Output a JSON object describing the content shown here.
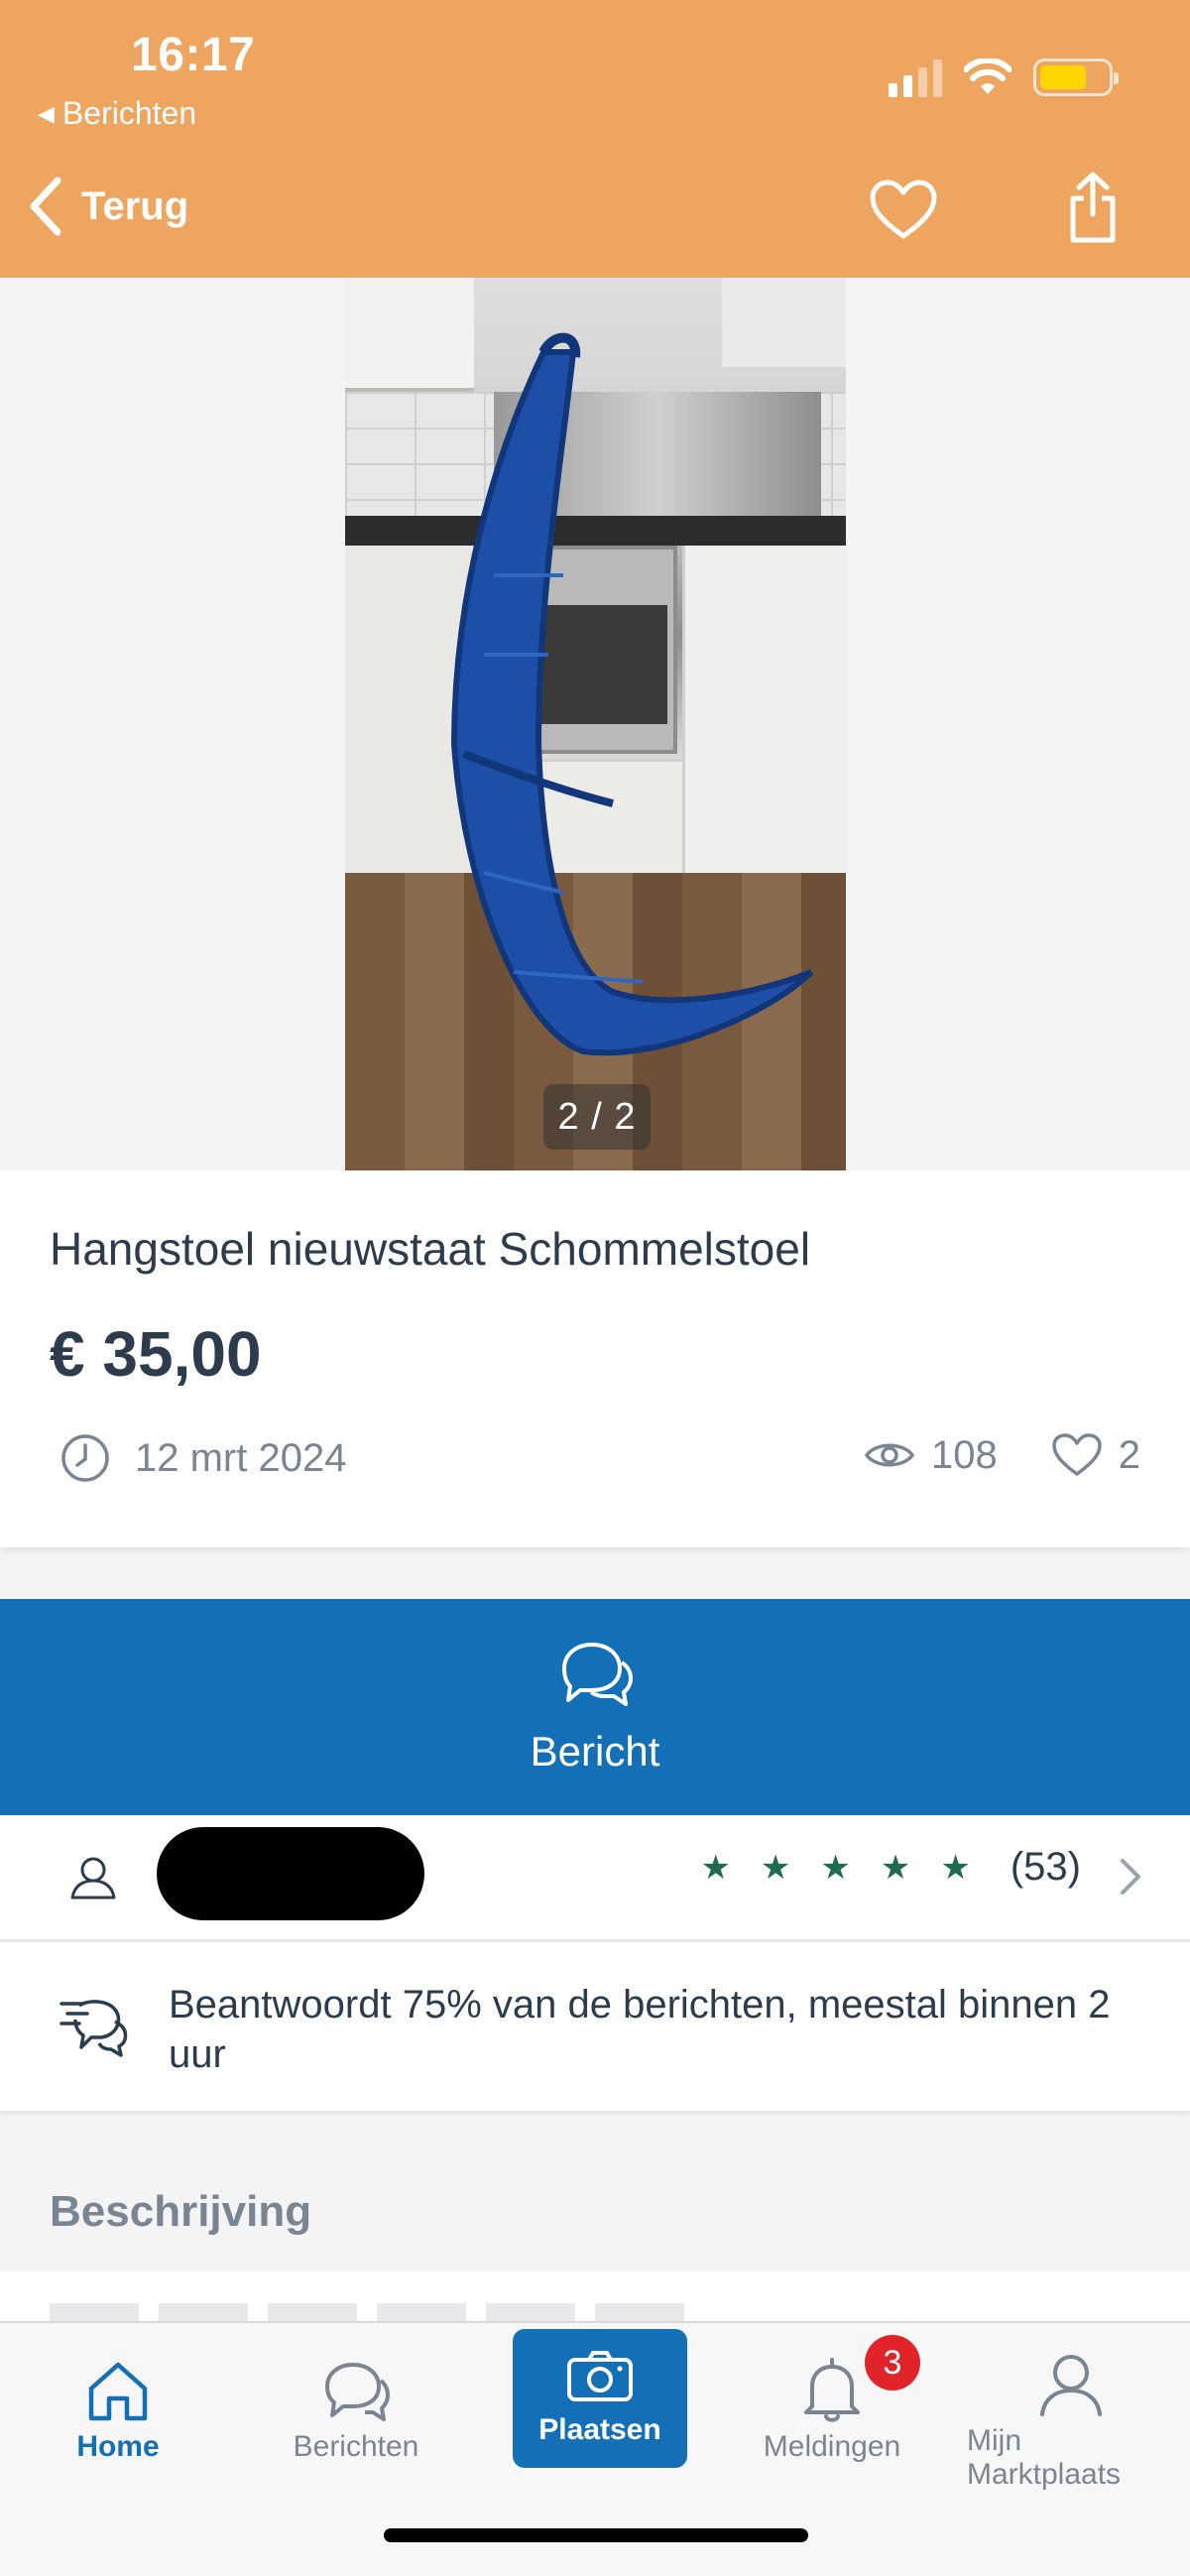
{
  "status_bar": {
    "time": "16:17",
    "back_app": "Berichten",
    "battery_color": "#ffd600"
  },
  "nav": {
    "back_label": "Terug",
    "icons": [
      "chevron-left-icon",
      "heart-icon",
      "share-icon"
    ]
  },
  "gallery": {
    "counter": "2 / 2",
    "current_image": 2,
    "total_images": 2
  },
  "listing": {
    "title": "Hangstoel nieuwstaat Schommelstoel",
    "price": "€ 35,00",
    "date": "12 mrt 2024",
    "views": "108",
    "favorites": "2"
  },
  "message_button": {
    "label": "Bericht"
  },
  "seller": {
    "rating_stars": 5,
    "review_count": "(53)"
  },
  "response": {
    "text": "Beantwoordt 75% van de berichten, meestal binnen 2 uur"
  },
  "description": {
    "heading": "Beschrijving"
  },
  "tabbar": {
    "tabs": [
      {
        "label": "Home",
        "icon": "home-icon",
        "active": true
      },
      {
        "label": "Berichten",
        "icon": "chat-icon",
        "active": false
      },
      {
        "label": "Plaatsen",
        "icon": "camera-icon",
        "active": false
      },
      {
        "label": "Meldingen",
        "icon": "bell-icon",
        "active": false
      },
      {
        "label": "Mijn Marktplaats",
        "icon": "user-icon",
        "active": false
      }
    ],
    "notification_badge": "3"
  },
  "colors": {
    "header": "#eea55f",
    "primary": "#1470b6",
    "star": "#1e6b4f",
    "badge": "#e1242a"
  }
}
